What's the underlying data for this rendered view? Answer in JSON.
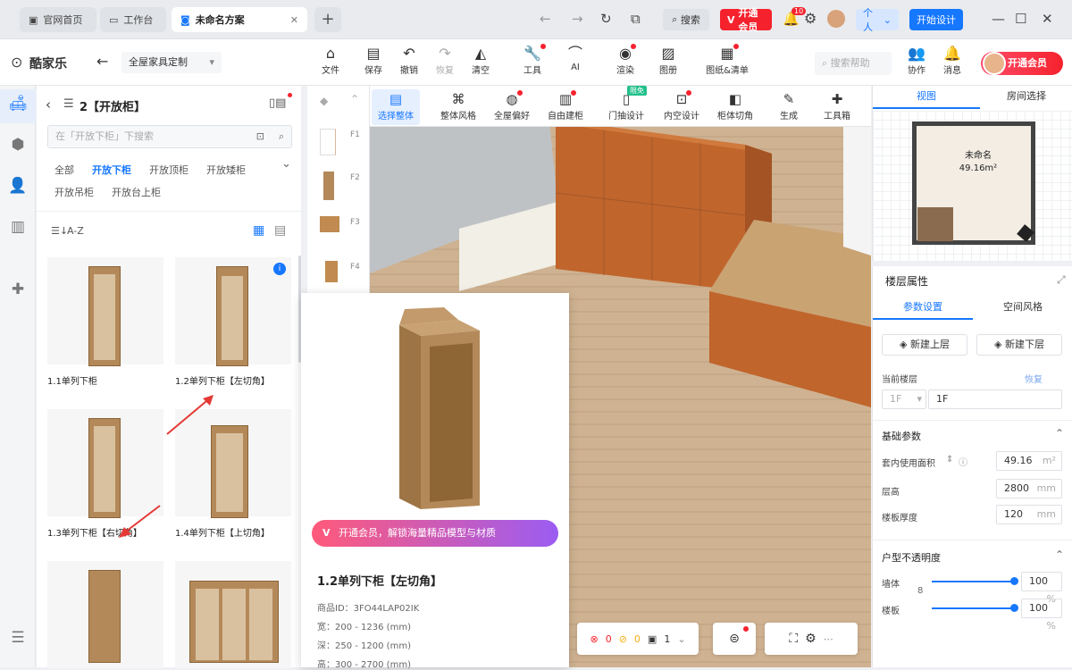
{
  "browser": {
    "tabs": [
      {
        "label": "官网首页"
      },
      {
        "label": "工作台"
      },
      {
        "label": "未命名方案"
      }
    ],
    "search_label": "搜索",
    "vip_badge": "开通会员",
    "notif_count": "10",
    "account_label": "个人",
    "start_design": "开始设计"
  },
  "app": {
    "logo": "酷家乐",
    "project_select": "全屋家具定制",
    "toolbar": [
      {
        "label": "文件",
        "icon": "file-icon"
      },
      {
        "label": "保存",
        "icon": "save-icon"
      },
      {
        "label": "撤销",
        "icon": "undo-icon"
      },
      {
        "label": "恢复",
        "icon": "redo-icon"
      },
      {
        "label": "清空",
        "icon": "eraser-icon"
      },
      {
        "label": "工具",
        "icon": "wrench-icon"
      },
      {
        "label": "AI",
        "icon": "ai-icon"
      },
      {
        "label": "渲染",
        "icon": "camera-icon"
      },
      {
        "label": "图册",
        "icon": "album-icon"
      },
      {
        "label": "图纸&清单",
        "icon": "drawing-icon"
      }
    ],
    "help_search_placeholder": "搜索帮助",
    "collab": "协作",
    "messages": "消息",
    "vip_btn": "开通会员"
  },
  "left_panel": {
    "title": "2【开放柜】",
    "search_placeholder": "在「开放下柜」下搜索",
    "filters": [
      "全部",
      "开放下柜",
      "开放顶柜",
      "开放矮柜",
      "开放吊柜",
      "开放台上柜"
    ],
    "active_filter": "开放下柜",
    "sort_label": "A-Z",
    "products": [
      {
        "label": "1.1单列下柜"
      },
      {
        "label": "1.2单列下柜【左切角】"
      },
      {
        "label": "1.3单列下柜【右切角】"
      },
      {
        "label": "1.4单列下柜【上切角】"
      },
      {
        "label": ""
      },
      {
        "label": ""
      }
    ]
  },
  "strip": {
    "floors": [
      "F1",
      "F2",
      "F3",
      "F4"
    ]
  },
  "viewport_tools": [
    {
      "label": "选择整体"
    },
    {
      "label": "整体风格"
    },
    {
      "label": "全屋偏好"
    },
    {
      "label": "自由建柜"
    },
    {
      "label": "门抽设计"
    },
    {
      "label": "内空设计"
    },
    {
      "label": "柜体切角"
    },
    {
      "label": "生成"
    },
    {
      "label": "工具箱"
    }
  ],
  "new_badge": "限免",
  "popup": {
    "banner": "开通会员，解锁海量精品模型与材质",
    "title": "1.2单列下柜【左切角】",
    "id": "商品ID：3FO44LAP02IK",
    "width": "宽：200 - 1236 (mm)",
    "depth": "深：250 - 1200 (mm)",
    "height": "高：300 - 2700 (mm)"
  },
  "status": {
    "errors": "0",
    "warnings": "0",
    "pages": "1"
  },
  "map": {
    "tab_view": "视图",
    "tab_room": "房间选择",
    "room_name": "未命名",
    "room_area": "49.16m²"
  },
  "props": {
    "title": "楼层属性",
    "tab_params": "参数设置",
    "tab_style": "空间风格",
    "new_upper": "新建上层",
    "new_lower": "新建下层",
    "current_floor_label": "当前楼层",
    "restore": "恢复",
    "floor_select": "1F",
    "floor_name": "1F",
    "basic_params": "基础参数",
    "area_label": "套内使用面积",
    "area_value": "49.16",
    "area_unit": "m²",
    "height_label": "层高",
    "height_value": "2800",
    "thick_label": "楼板厚度",
    "thick_value": "120",
    "mm": "mm",
    "opacity_title": "户型不透明度",
    "wall_label": "墙体",
    "wall_value": "100",
    "floor_label": "楼板",
    "floor_value": "100",
    "pct": "%"
  },
  "colors": {
    "accent": "#1677ff",
    "vip": "#f5222d",
    "wood": "#b4895a",
    "cabinet": "#c0652c"
  }
}
